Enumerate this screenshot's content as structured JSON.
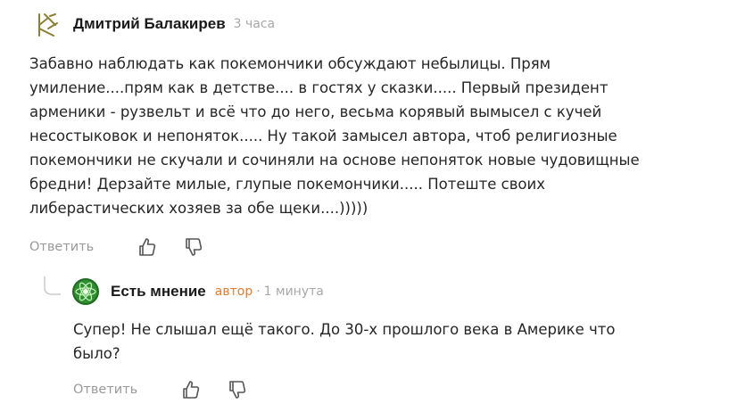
{
  "comment": {
    "author": "Дмитрий Балакирев",
    "time": "3 часа",
    "text": "Забавно наблюдать как покемончики обсуждают небылицы. Прям\nумиление....прям как в детстве.... в гостях у сказки..... Первый президент\nарменики - рузвельт и всё что до него, весьма корявый вымысел с кучей\nнесостыковок и непоняток..... Ну такой замысел автора, чтоб религиозные\nпокемончики не скучали и сочиняли на основе непоняток новые чудовищные\nбредни! Дерзайте милые, глупые покемончики..... Потеште своих\nлиберастических хозяев за обе щеки....)))))",
    "actions": {
      "reply": "Ответить"
    }
  },
  "reply": {
    "author": "Есть мнение",
    "author_tag": "автор",
    "separator": "·",
    "time": "1 минута",
    "text": "Супер! Не слышал ещё такого. До 30-х прошлого века в Америке что\nбыло?",
    "actions": {
      "reply": "Ответить"
    }
  },
  "icons": {
    "avatar_main": "rune-avatar-icon",
    "avatar_reply": "atom-avatar-icon",
    "like": "thumbs-up-icon",
    "dislike": "thumbs-down-icon"
  },
  "colors": {
    "author_tag": "#e87b2c",
    "muted": "#a8a8a8",
    "avatar_main": "#8b8033",
    "avatar_reply": "#2f8f2f"
  }
}
